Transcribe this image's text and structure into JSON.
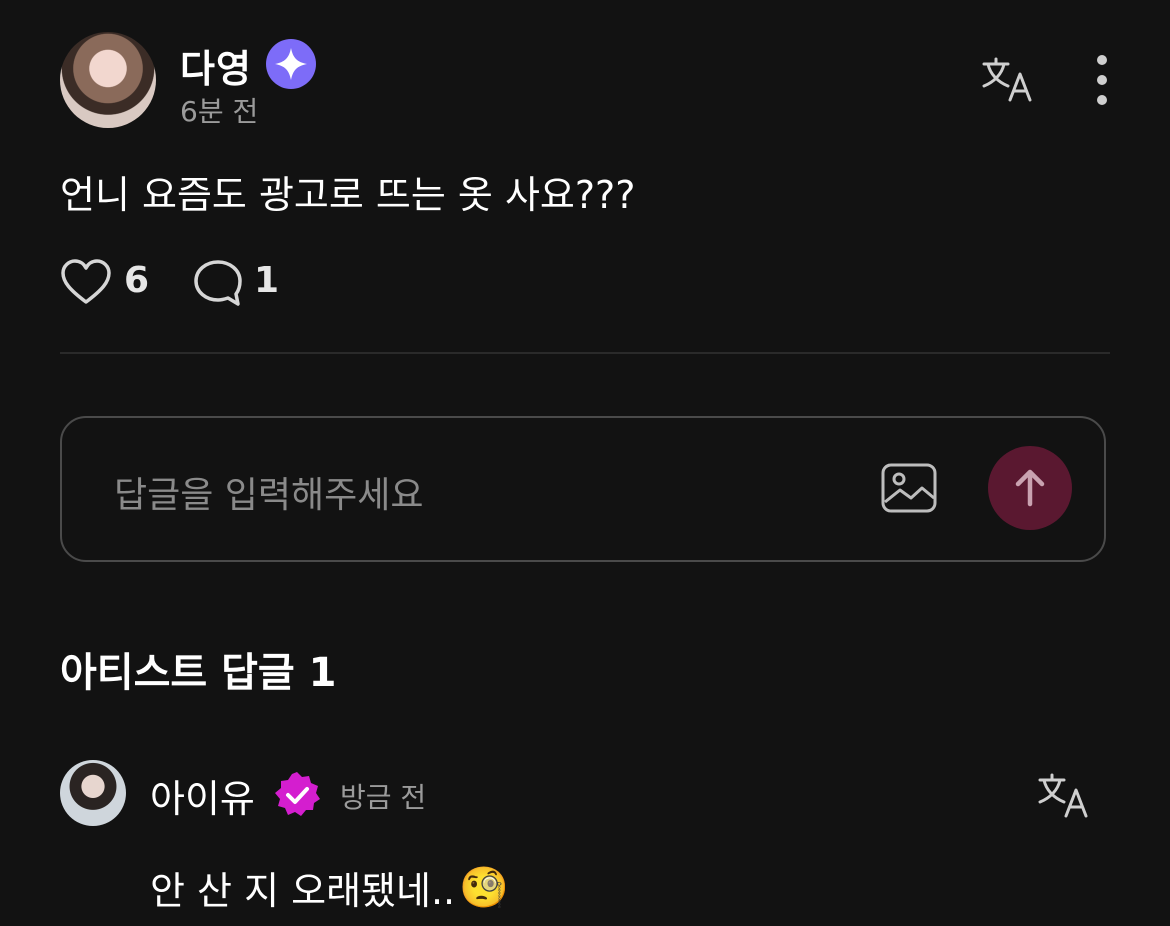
{
  "post": {
    "author": "다영",
    "time": "6분 전",
    "content": "언니 요즘도 광고로 뜨는 옷 사요???",
    "likes": "6",
    "comments": "1"
  },
  "reply_input": {
    "placeholder": "답글을 입력해주세요"
  },
  "artist_section": {
    "title": "아티스트 답글 1",
    "reply": {
      "author": "아이유",
      "time": "방금 전",
      "text": "안 산 지 오래됐네..",
      "emoji": "🧐"
    }
  },
  "colors": {
    "background": "#121212",
    "star_badge": "#7d6cf8",
    "verified_badge": "#d41ecf",
    "send_button": "#5a1830"
  },
  "icons": [
    "sparkle-badge-icon",
    "translate-icon",
    "more-vertical-icon",
    "heart-icon",
    "comment-icon",
    "image-icon",
    "arrow-up-icon",
    "verified-badge-icon"
  ]
}
